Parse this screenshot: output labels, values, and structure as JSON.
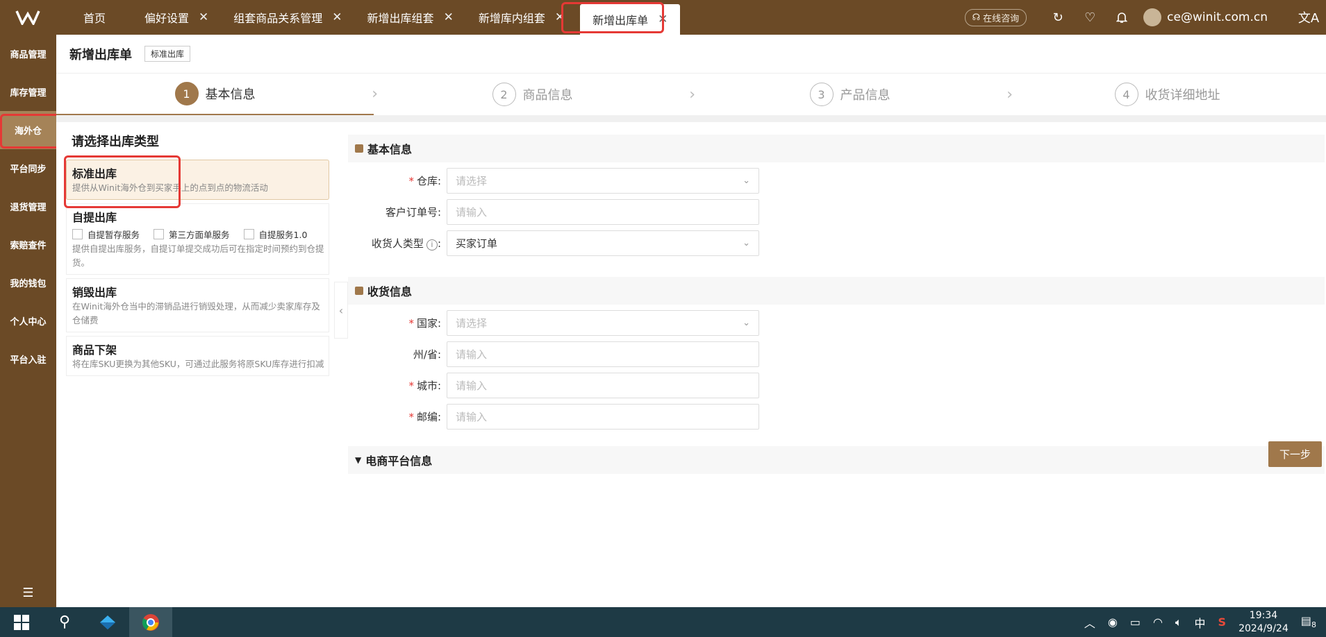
{
  "top_tabs": [
    {
      "label": "首页"
    },
    {
      "label": "偏好设置"
    },
    {
      "label": "组套商品关系管理"
    },
    {
      "label": "新增出库组套"
    },
    {
      "label": "新增库内组套"
    },
    {
      "label": "新增出库单"
    }
  ],
  "topbar": {
    "consult_label": "在线咨询",
    "user_email": "ce@winit.com.cn"
  },
  "sidebar": {
    "items": [
      {
        "label": "商品管理"
      },
      {
        "label": "库存管理"
      },
      {
        "label": "海外仓"
      },
      {
        "label": "平台同步"
      },
      {
        "label": "退货管理"
      },
      {
        "label": "索赔查件"
      },
      {
        "label": "我的钱包"
      },
      {
        "label": "个人中心"
      },
      {
        "label": "平台入驻"
      }
    ]
  },
  "page": {
    "title": "新增出库单",
    "tag": "标准出库"
  },
  "steps": [
    {
      "num": "1",
      "label": "基本信息"
    },
    {
      "num": "2",
      "label": "商品信息"
    },
    {
      "num": "3",
      "label": "产品信息"
    },
    {
      "num": "4",
      "label": "收货详细地址"
    }
  ],
  "outbound": {
    "heading": "请选择出库类型",
    "standard": {
      "title": "标准出库",
      "desc": "提供从Winit海外仓到买家手上的点到点的物流活动"
    },
    "pickup": {
      "title": "自提出库",
      "options": [
        "自提暂存服务",
        "第三方面单服务",
        "自提服务1.0"
      ],
      "desc": "提供自提出库服务，自提订单提交成功后可在指定时间预约到仓提货。"
    },
    "destroy": {
      "title": "销毁出库",
      "desc": "在Winit海外仓当中的滞销品进行销毁处理，从而减少卖家库存及仓储费"
    },
    "delist": {
      "title": "商品下架",
      "desc": "将在库SKU更换为其他SKU，可通过此服务将原SKU库存进行扣减"
    }
  },
  "form": {
    "basic_title": "基本信息",
    "warehouse_label": "仓库:",
    "warehouse_ph": "请选择",
    "order_no_label": "客户订单号:",
    "order_no_ph": "请输入",
    "receiver_type_label": "收货人类型",
    "receiver_type_value": "买家订单",
    "receive_title": "收货信息",
    "country_label": "国家:",
    "country_ph": "请选择",
    "state_label": "州/省:",
    "state_ph": "请输入",
    "city_label": "城市:",
    "city_ph": "请输入",
    "zip_label": "邮编:",
    "zip_ph": "请输入",
    "ecom_title": "电商平台信息",
    "next_label": "下一步"
  },
  "taskbar": {
    "ime": "中",
    "time": "19:34",
    "date": "2024/9/24",
    "notif_count": "8"
  }
}
